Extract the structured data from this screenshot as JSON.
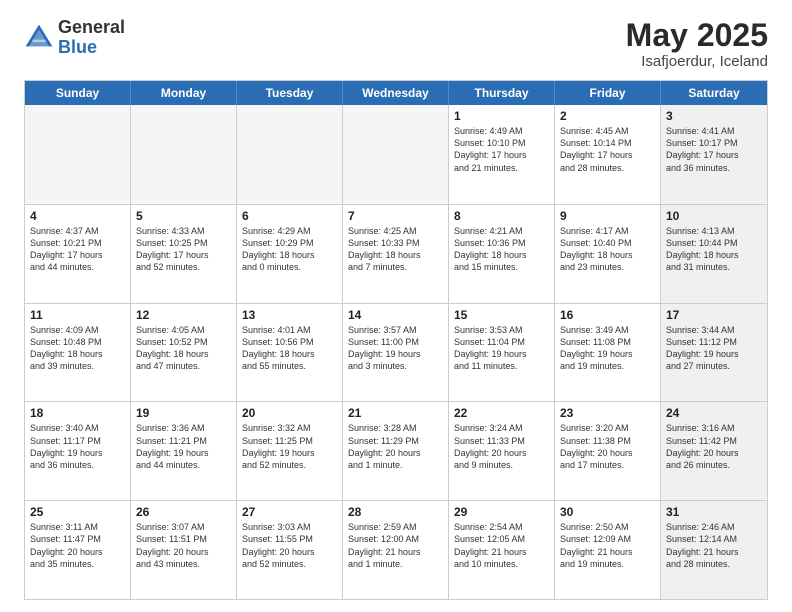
{
  "header": {
    "logo_general": "General",
    "logo_blue": "Blue",
    "month_title": "May 2025",
    "location": "Isafjoerdur, Iceland"
  },
  "weekdays": [
    "Sunday",
    "Monday",
    "Tuesday",
    "Wednesday",
    "Thursday",
    "Friday",
    "Saturday"
  ],
  "rows": [
    [
      {
        "day": "",
        "empty": true
      },
      {
        "day": "",
        "empty": true
      },
      {
        "day": "",
        "empty": true
      },
      {
        "day": "",
        "empty": true
      },
      {
        "day": "1",
        "line1": "Sunrise: 4:49 AM",
        "line2": "Sunset: 10:10 PM",
        "line3": "Daylight: 17 hours",
        "line4": "and 21 minutes."
      },
      {
        "day": "2",
        "line1": "Sunrise: 4:45 AM",
        "line2": "Sunset: 10:14 PM",
        "line3": "Daylight: 17 hours",
        "line4": "and 28 minutes."
      },
      {
        "day": "3",
        "line1": "Sunrise: 4:41 AM",
        "line2": "Sunset: 10:17 PM",
        "line3": "Daylight: 17 hours",
        "line4": "and 36 minutes.",
        "shaded": true
      }
    ],
    [
      {
        "day": "4",
        "line1": "Sunrise: 4:37 AM",
        "line2": "Sunset: 10:21 PM",
        "line3": "Daylight: 17 hours",
        "line4": "and 44 minutes."
      },
      {
        "day": "5",
        "line1": "Sunrise: 4:33 AM",
        "line2": "Sunset: 10:25 PM",
        "line3": "Daylight: 17 hours",
        "line4": "and 52 minutes."
      },
      {
        "day": "6",
        "line1": "Sunrise: 4:29 AM",
        "line2": "Sunset: 10:29 PM",
        "line3": "Daylight: 18 hours",
        "line4": "and 0 minutes."
      },
      {
        "day": "7",
        "line1": "Sunrise: 4:25 AM",
        "line2": "Sunset: 10:33 PM",
        "line3": "Daylight: 18 hours",
        "line4": "and 7 minutes."
      },
      {
        "day": "8",
        "line1": "Sunrise: 4:21 AM",
        "line2": "Sunset: 10:36 PM",
        "line3": "Daylight: 18 hours",
        "line4": "and 15 minutes."
      },
      {
        "day": "9",
        "line1": "Sunrise: 4:17 AM",
        "line2": "Sunset: 10:40 PM",
        "line3": "Daylight: 18 hours",
        "line4": "and 23 minutes."
      },
      {
        "day": "10",
        "line1": "Sunrise: 4:13 AM",
        "line2": "Sunset: 10:44 PM",
        "line3": "Daylight: 18 hours",
        "line4": "and 31 minutes.",
        "shaded": true
      }
    ],
    [
      {
        "day": "11",
        "line1": "Sunrise: 4:09 AM",
        "line2": "Sunset: 10:48 PM",
        "line3": "Daylight: 18 hours",
        "line4": "and 39 minutes."
      },
      {
        "day": "12",
        "line1": "Sunrise: 4:05 AM",
        "line2": "Sunset: 10:52 PM",
        "line3": "Daylight: 18 hours",
        "line4": "and 47 minutes."
      },
      {
        "day": "13",
        "line1": "Sunrise: 4:01 AM",
        "line2": "Sunset: 10:56 PM",
        "line3": "Daylight: 18 hours",
        "line4": "and 55 minutes."
      },
      {
        "day": "14",
        "line1": "Sunrise: 3:57 AM",
        "line2": "Sunset: 11:00 PM",
        "line3": "Daylight: 19 hours",
        "line4": "and 3 minutes."
      },
      {
        "day": "15",
        "line1": "Sunrise: 3:53 AM",
        "line2": "Sunset: 11:04 PM",
        "line3": "Daylight: 19 hours",
        "line4": "and 11 minutes."
      },
      {
        "day": "16",
        "line1": "Sunrise: 3:49 AM",
        "line2": "Sunset: 11:08 PM",
        "line3": "Daylight: 19 hours",
        "line4": "and 19 minutes."
      },
      {
        "day": "17",
        "line1": "Sunrise: 3:44 AM",
        "line2": "Sunset: 11:12 PM",
        "line3": "Daylight: 19 hours",
        "line4": "and 27 minutes.",
        "shaded": true
      }
    ],
    [
      {
        "day": "18",
        "line1": "Sunrise: 3:40 AM",
        "line2": "Sunset: 11:17 PM",
        "line3": "Daylight: 19 hours",
        "line4": "and 36 minutes."
      },
      {
        "day": "19",
        "line1": "Sunrise: 3:36 AM",
        "line2": "Sunset: 11:21 PM",
        "line3": "Daylight: 19 hours",
        "line4": "and 44 minutes."
      },
      {
        "day": "20",
        "line1": "Sunrise: 3:32 AM",
        "line2": "Sunset: 11:25 PM",
        "line3": "Daylight: 19 hours",
        "line4": "and 52 minutes."
      },
      {
        "day": "21",
        "line1": "Sunrise: 3:28 AM",
        "line2": "Sunset: 11:29 PM",
        "line3": "Daylight: 20 hours",
        "line4": "and 1 minute."
      },
      {
        "day": "22",
        "line1": "Sunrise: 3:24 AM",
        "line2": "Sunset: 11:33 PM",
        "line3": "Daylight: 20 hours",
        "line4": "and 9 minutes."
      },
      {
        "day": "23",
        "line1": "Sunrise: 3:20 AM",
        "line2": "Sunset: 11:38 PM",
        "line3": "Daylight: 20 hours",
        "line4": "and 17 minutes."
      },
      {
        "day": "24",
        "line1": "Sunrise: 3:16 AM",
        "line2": "Sunset: 11:42 PM",
        "line3": "Daylight: 20 hours",
        "line4": "and 26 minutes.",
        "shaded": true
      }
    ],
    [
      {
        "day": "25",
        "line1": "Sunrise: 3:11 AM",
        "line2": "Sunset: 11:47 PM",
        "line3": "Daylight: 20 hours",
        "line4": "and 35 minutes."
      },
      {
        "day": "26",
        "line1": "Sunrise: 3:07 AM",
        "line2": "Sunset: 11:51 PM",
        "line3": "Daylight: 20 hours",
        "line4": "and 43 minutes."
      },
      {
        "day": "27",
        "line1": "Sunrise: 3:03 AM",
        "line2": "Sunset: 11:55 PM",
        "line3": "Daylight: 20 hours",
        "line4": "and 52 minutes."
      },
      {
        "day": "28",
        "line1": "Sunrise: 2:59 AM",
        "line2": "Sunset: 12:00 AM",
        "line3": "Daylight: 21 hours",
        "line4": "and 1 minute."
      },
      {
        "day": "29",
        "line1": "Sunrise: 2:54 AM",
        "line2": "Sunset: 12:05 AM",
        "line3": "Daylight: 21 hours",
        "line4": "and 10 minutes."
      },
      {
        "day": "30",
        "line1": "Sunrise: 2:50 AM",
        "line2": "Sunset: 12:09 AM",
        "line3": "Daylight: 21 hours",
        "line4": "and 19 minutes."
      },
      {
        "day": "31",
        "line1": "Sunrise: 2:46 AM",
        "line2": "Sunset: 12:14 AM",
        "line3": "Daylight: 21 hours",
        "line4": "and 28 minutes.",
        "shaded": true
      }
    ]
  ]
}
